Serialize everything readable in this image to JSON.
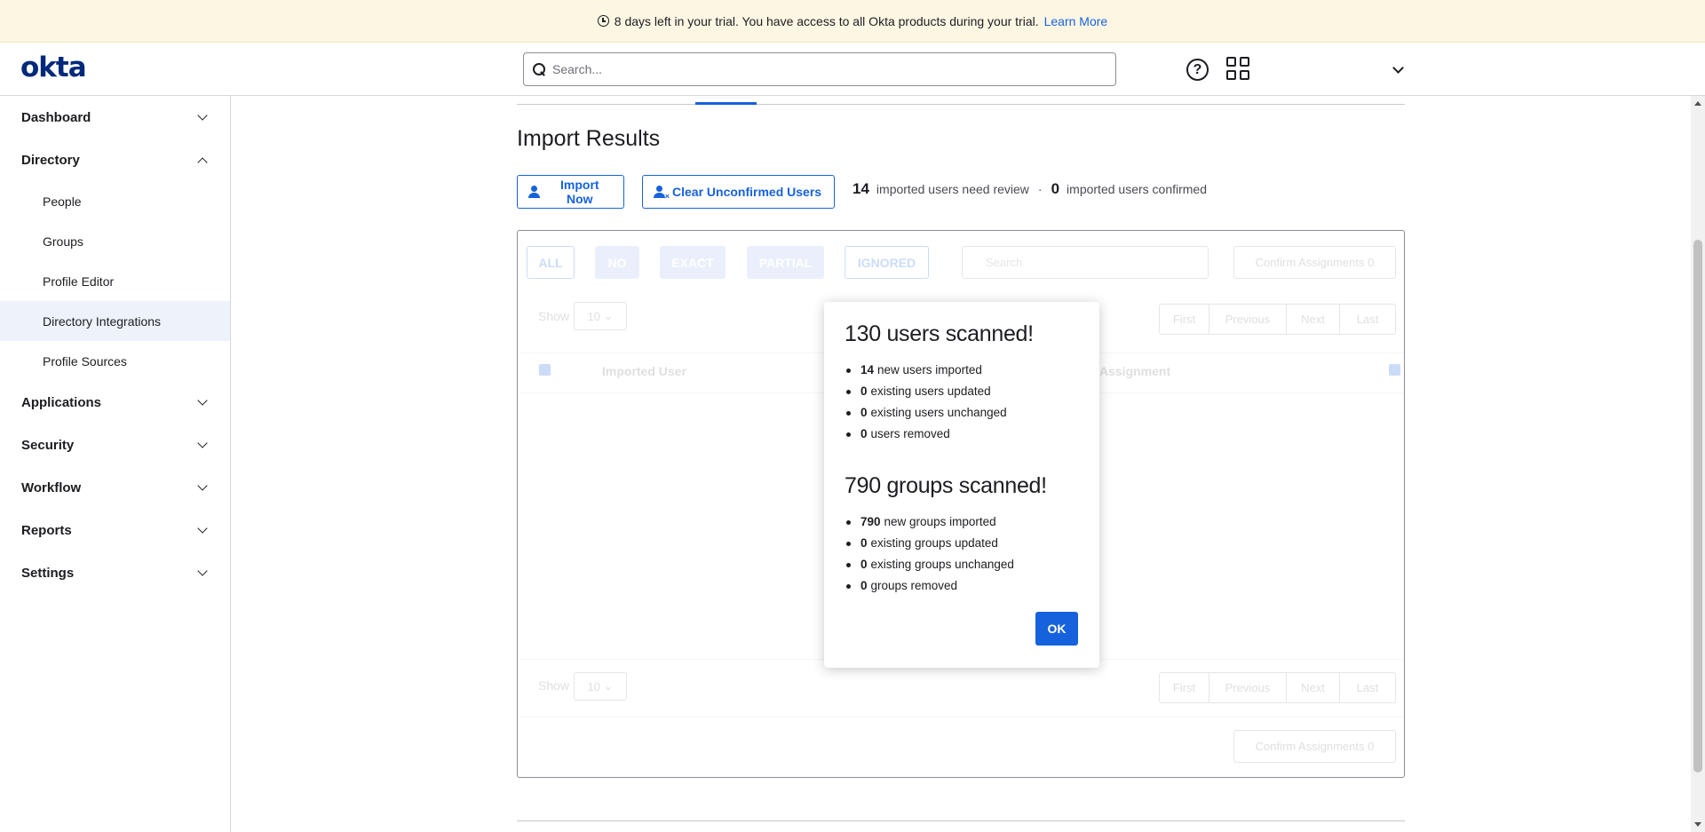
{
  "banner": {
    "text": "8 days left in your trial. You have access to all Okta products during your trial.",
    "link": "Learn More"
  },
  "header": {
    "logo": "okta",
    "search_placeholder": "Search..."
  },
  "sidebar": {
    "items": [
      {
        "label": "Dashboard",
        "expanded": false
      },
      {
        "label": "Directory",
        "expanded": true,
        "children": [
          {
            "label": "People"
          },
          {
            "label": "Groups"
          },
          {
            "label": "Profile Editor"
          },
          {
            "label": "Directory Integrations",
            "active": true
          },
          {
            "label": "Profile Sources"
          }
        ]
      },
      {
        "label": "Applications",
        "expanded": false
      },
      {
        "label": "Security",
        "expanded": false
      },
      {
        "label": "Workflow",
        "expanded": false
      },
      {
        "label": "Reports",
        "expanded": false
      },
      {
        "label": "Settings",
        "expanded": false
      }
    ]
  },
  "main": {
    "title": "Import Results",
    "import_now": "Import Now",
    "clear_unconfirmed": "Clear Unconfirmed Users",
    "review_count": "14",
    "review_text": "imported users need review",
    "separator": "·",
    "confirmed_count": "0",
    "confirmed_text": "imported users confirmed"
  },
  "table": {
    "filters": [
      "ALL",
      "NO",
      "EXACT",
      "PARTIAL",
      "IGNORED"
    ],
    "search_placeholder": "Search",
    "confirm_label": "Confirm Assignments 0",
    "show_label": "Show",
    "page_size": "10",
    "pager": [
      "First",
      "Previous",
      "Next",
      "Last"
    ],
    "col_imported_user": "Imported User",
    "col_assignment": "Assignment"
  },
  "modal": {
    "users_title": "130 users scanned!",
    "users": [
      {
        "count": "14",
        "label": "new users imported"
      },
      {
        "count": "0",
        "label": "existing users updated"
      },
      {
        "count": "0",
        "label": "existing users unchanged"
      },
      {
        "count": "0",
        "label": "users removed"
      }
    ],
    "groups_title": "790 groups scanned!",
    "groups": [
      {
        "count": "790",
        "label": "new groups imported"
      },
      {
        "count": "0",
        "label": "existing groups updated"
      },
      {
        "count": "0",
        "label": "existing groups unchanged"
      },
      {
        "count": "0",
        "label": "groups removed"
      }
    ],
    "ok": "OK"
  },
  "colors": {
    "accent": "#1662dd",
    "banner_bg": "#fdf6e3",
    "logo": "#00297a"
  }
}
